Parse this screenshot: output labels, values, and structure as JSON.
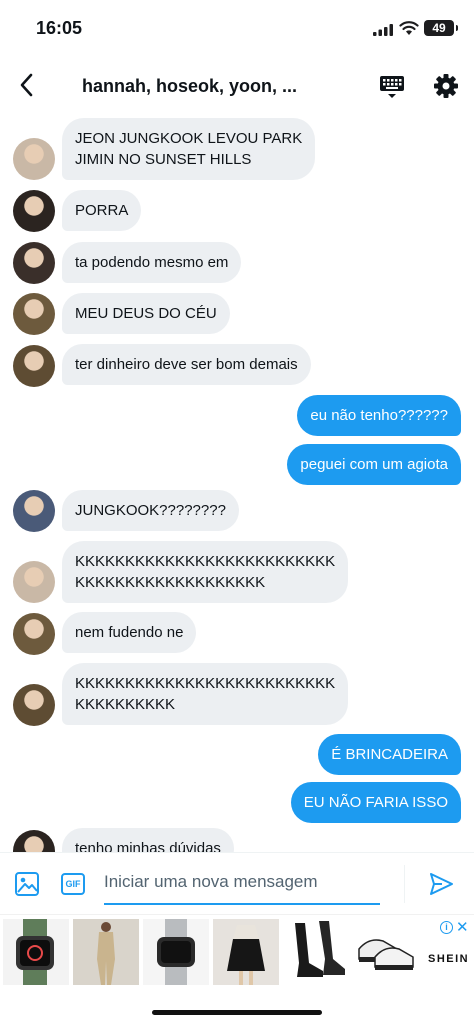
{
  "status_bar": {
    "time": "16:05",
    "battery": "49"
  },
  "header": {
    "title": "hannah, hoseok, yoon, ..."
  },
  "messages": [
    {
      "side": "in",
      "text": "JEON JUNGKOOK LEVOU PARK\nJIMIN NO SUNSET HILLS",
      "avatar_color": "#c9b8a6"
    },
    {
      "side": "in",
      "text": "PORRA",
      "avatar_color": "#2b2420"
    },
    {
      "side": "in",
      "text": "ta podendo mesmo em",
      "avatar_color": "#3a2f2a"
    },
    {
      "side": "in",
      "text": "MEU DEUS DO CÉU",
      "avatar_color": "#6d5a3d"
    },
    {
      "side": "in",
      "text": "ter dinheiro deve ser bom demais",
      "avatar_color": "#5e4c33"
    },
    {
      "side": "out",
      "text": "eu não tenho??????"
    },
    {
      "side": "out",
      "text": "peguei com um agiota"
    },
    {
      "side": "in",
      "text": "JUNGKOOK????????",
      "avatar_color": "#4a5a78"
    },
    {
      "side": "in",
      "text": "KKKKKKKKKKKKKKKKKKKKKKKKKK\nKKKKKKKKKKKKKKKKKKK",
      "avatar_color": "#c9b8a6"
    },
    {
      "side": "in",
      "text": "nem fudendo ne",
      "avatar_color": "#6d5a3d"
    },
    {
      "side": "in",
      "text": "KKKKKKKKKKKKKKKKKKKKKKKKKK\nKKKKKKKKKK",
      "avatar_color": "#5e4c33"
    },
    {
      "side": "out",
      "text": "É BRINCADEIRA"
    },
    {
      "side": "out",
      "text": "EU NÃO FARIA ISSO"
    },
    {
      "side": "in",
      "text": "tenho minhas dúvidas",
      "avatar_color": "#2b2420"
    }
  ],
  "composer": {
    "placeholder": "Iniciar uma nova mensagem",
    "gif_label": "GIF"
  },
  "ad": {
    "brand": "SHEIN",
    "info_label": "i",
    "close_label": "✕",
    "products": [
      "smartwatch-green",
      "jumpsuit-beige",
      "watch-band-silver",
      "leather-skirt-black",
      "thigh-boots-black",
      "sneakers-black-white"
    ]
  },
  "colors": {
    "accent": "#1d9bf0",
    "incoming_bubble": "#eceff2",
    "text": "#0f1419"
  },
  "icons": [
    "back-arrow-icon",
    "keyboard-icon",
    "gear-icon",
    "image-icon",
    "gif-icon",
    "send-icon",
    "ad-info-icon",
    "close-icon"
  ]
}
